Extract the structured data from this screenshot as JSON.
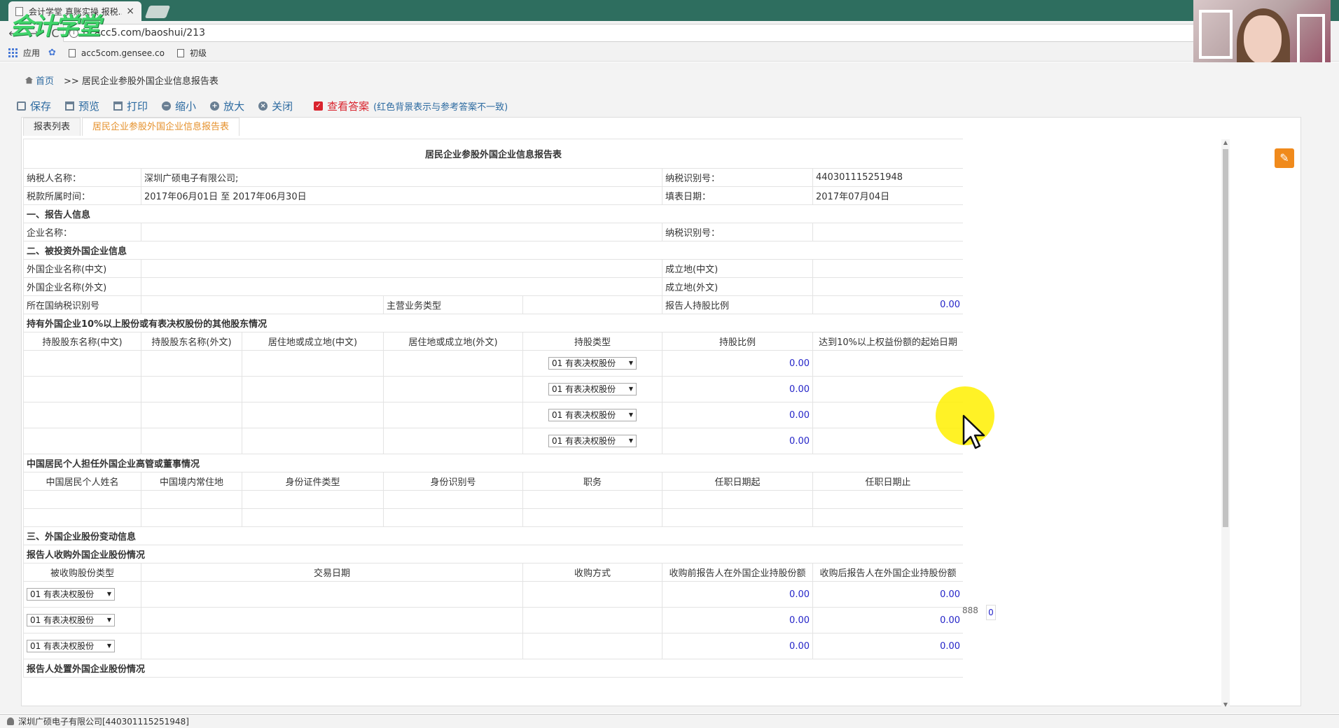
{
  "browser": {
    "tab_title": "会计学堂 真账实操 报税...",
    "tab_close": "×",
    "url": "lx.acc5.com/baoshui/213",
    "logo_text": "会计学堂",
    "bookmarks": [
      "应用",
      "acc5com.gensee.co",
      "初级"
    ]
  },
  "breadcrumb": {
    "home": "首页",
    "current": ">> 居民企业参股外国企业信息报告表"
  },
  "toolbar": {
    "save": "保存",
    "preview": "预览",
    "print": "打印",
    "zoom_out": "缩小",
    "zoom_in": "放大",
    "close": "关闭",
    "answer": "查看答案",
    "note": "(红色背景表示与参考答案不一致)"
  },
  "tabs": [
    "报表列表",
    "居民企业参股外国企业信息报告表"
  ],
  "form": {
    "title": "居民企业参股外国企业信息报告表",
    "taxpayer_name_label": "纳税人名称：",
    "taxpayer_name": "深圳广硕电子有限公司;",
    "tax_id_label": "纳税识别号：",
    "tax_id": "440301115251948",
    "period_label": "税款所属时间：",
    "period": "2017年06月01日 至 2017年06月30日",
    "fill_date_label": "填表日期：",
    "fill_date": "2017年07月04日",
    "sec1": "一、报告人信息",
    "company_name_label": "企业名称：",
    "company_tax_id_label": "纳税识别号：",
    "sec2": "二、被投资外国企业信息",
    "foreign_name_cn": "外国企业名称(中文)",
    "foreign_name_en": "外国企业名称(外文)",
    "est_place_cn": "成立地(中文)",
    "est_place_en": "成立地(外文)",
    "country_tax_id": "所在国纳税识别号",
    "main_business": "主营业务类型",
    "holding_ratio_label": "报告人持股比例",
    "holding_ratio": "0.00",
    "shareholders_title": "持有外国企业10%以上股份或有表决权股份的其他股东情况",
    "shareholders_headers": [
      "持股股东名称(中文)",
      "持股股东名称(外文)",
      "居住地或成立地(中文)",
      "居住地或成立地(外文)",
      "持股类型",
      "持股比例",
      "达到10%以上权益份额的起始日期"
    ],
    "shareholder_rows": [
      {
        "type": "01 有表决权股份",
        "ratio": "0.00"
      },
      {
        "type": "01 有表决权股份",
        "ratio": "0.00"
      },
      {
        "type": "01 有表决权股份",
        "ratio": "0.00"
      },
      {
        "type": "01 有表决权股份",
        "ratio": "0.00"
      }
    ],
    "executives_title": "中国居民个人担任外国企业高管或董事情况",
    "executives_headers": [
      "中国居民个人姓名",
      "中国境内常住地",
      "身份证件类型",
      "身份识别号",
      "职务",
      "任职日期起",
      "任职日期止"
    ],
    "sec3": "三、外国企业股份变动信息",
    "acquire_title": "报告人收购外国企业股份情况",
    "acquire_headers": [
      "被收购股份类型",
      "交易日期",
      "收购方式",
      "收购前报告人在外国企业持股份额",
      "收购后报告人在外国企业持股份额"
    ],
    "acquire_rows": [
      {
        "type": "01 有表决权股份",
        "before": "0.00",
        "after": "0.00"
      },
      {
        "type": "01 有表决权股份",
        "before": "0.00",
        "after": "0.00"
      },
      {
        "type": "01 有表决权股份",
        "before": "0.00",
        "after": "0.00"
      }
    ],
    "dispose_title": "报告人处置外国企业股份情况",
    "side_value": "888",
    "side_box": "0"
  },
  "status": "深圳广硕电子有限公司[440301115251948]"
}
